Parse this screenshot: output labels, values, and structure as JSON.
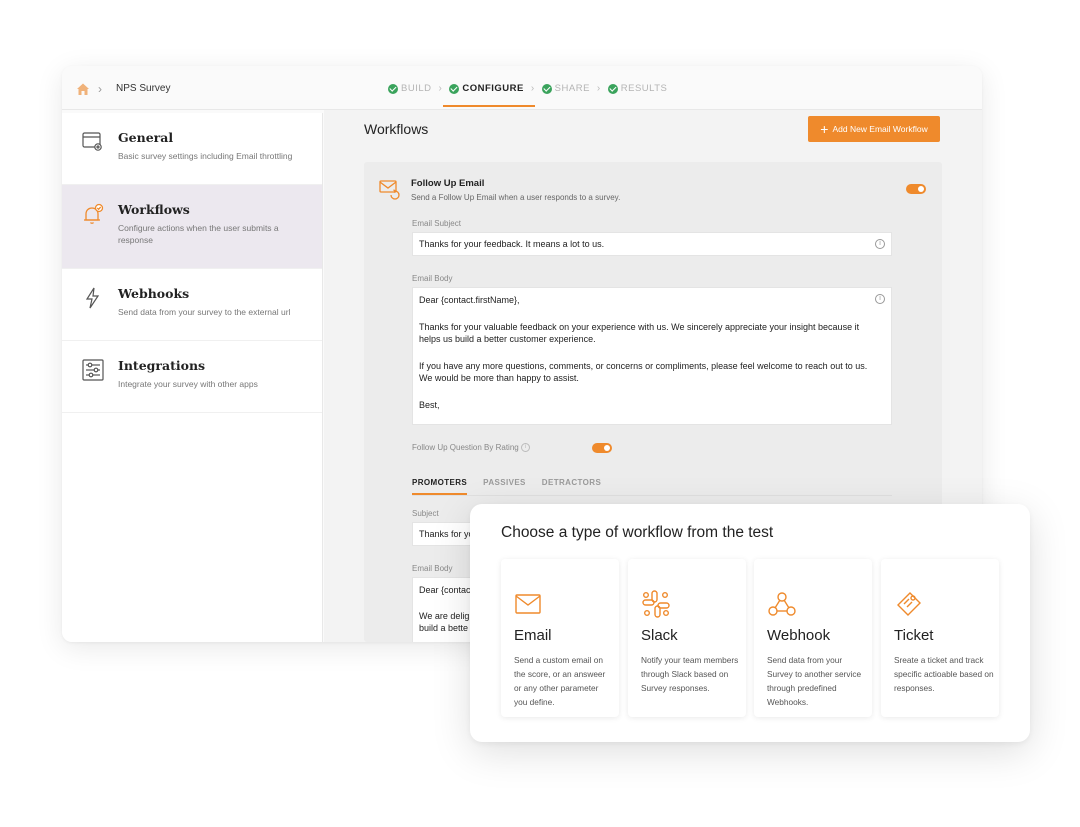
{
  "breadcrumb": {
    "title": "NPS Survey"
  },
  "steps": [
    {
      "label": "BUILD",
      "active": false
    },
    {
      "label": "CONFIGURE",
      "active": true
    },
    {
      "label": "SHARE",
      "active": false
    },
    {
      "label": "RESULTS",
      "active": false
    }
  ],
  "sidebar": {
    "items": [
      {
        "title": "General",
        "desc": "Basic survey settings including Email throttling",
        "icon": "settings-window-icon"
      },
      {
        "title": "Workflows",
        "desc": "Configure actions when the user submits a response",
        "icon": "bell-check-icon",
        "active": true
      },
      {
        "title": "Webhooks",
        "desc": "Send data from your survey to the external url",
        "icon": "lightning-icon"
      },
      {
        "title": "Integrations",
        "desc": "Integrate your survey with other apps",
        "icon": "sliders-icon"
      }
    ]
  },
  "main": {
    "title": "Workflows",
    "add_button": "Add New Email Workflow",
    "followup": {
      "title": "Follow Up Email",
      "desc": "Send a Follow Up Email when a user responds to a survey.",
      "enabled": true,
      "subject_label": "Email Subject",
      "subject_value": "Thanks for your feedback. It means a lot to us.",
      "body_label": "Email Body",
      "body_lines": [
        "Dear {contact.firstName},",
        "Thanks for your valuable feedback on your experience with us. We sincerely appreciate your insight because it helps us build a better customer experience.",
        "If you have any more questions, comments, or concerns or compliments, please feel welcome to reach out to us. We would be more than happy to assist.",
        "Best,"
      ],
      "rating_label": "Follow Up Question By Rating",
      "rating_enabled": true
    },
    "tabs": [
      "PROMOTERS",
      "PASSIVES",
      "DETRACTORS"
    ],
    "promoters": {
      "subject_label": "Subject",
      "subject_value": "Thanks for yo",
      "body_label": "Email Body",
      "body_line1": "Dear {contac",
      "body_line2": "We are deligh",
      "body_line3": "build a bette"
    }
  },
  "overlay": {
    "title": "Choose a type of workflow from the test",
    "cards": [
      {
        "title": "Email",
        "desc": "Send a custom email on the score, or an answeer or any other parameter you define.",
        "icon": "email-icon"
      },
      {
        "title": "Slack",
        "desc": "Notify your team members through Slack based on Survey responses.",
        "icon": "slack-icon"
      },
      {
        "title": "Webhook",
        "desc": "Send data from your Survey to another service through predefined Webhooks.",
        "icon": "webhook-icon"
      },
      {
        "title": "Ticket",
        "desc": "Sreate a ticket and track specific actioable based on responses.",
        "icon": "ticket-icon"
      }
    ]
  },
  "colors": {
    "accent": "#ef8a2c",
    "check": "#3aa35c",
    "active_nav": "#ece8ef"
  }
}
